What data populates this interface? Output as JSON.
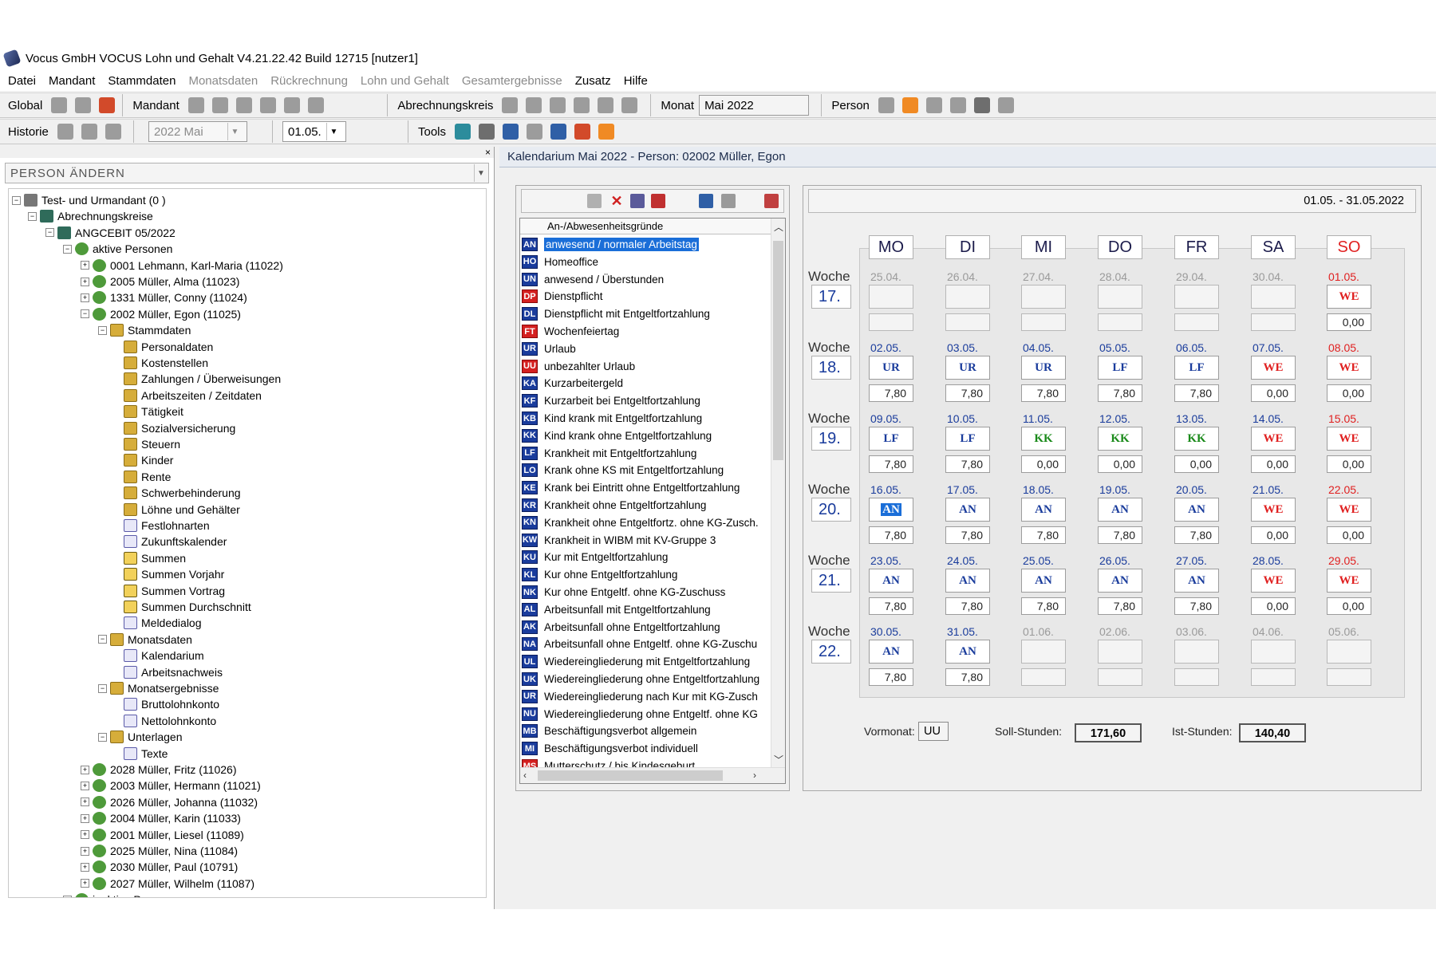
{
  "window": {
    "title": "Vocus GmbH VOCUS Lohn und Gehalt V4.21.22.42 Build 12715 [nutzer1]"
  },
  "menu": [
    {
      "label": "Datei",
      "enabled": true
    },
    {
      "label": "Mandant",
      "enabled": true
    },
    {
      "label": "Stammdaten",
      "enabled": true
    },
    {
      "label": "Monatsdaten",
      "enabled": false
    },
    {
      "label": "Rückrechnung",
      "enabled": false
    },
    {
      "label": "Lohn und Gehalt",
      "enabled": false
    },
    {
      "label": "Gesamtergebnisse",
      "enabled": false
    },
    {
      "label": "Zusatz",
      "enabled": true
    },
    {
      "label": "Hilfe",
      "enabled": true
    }
  ],
  "toolbar": {
    "global_label": "Global",
    "mandant_label": "Mandant",
    "abrechnungskreis_label": "Abrechnungskreis",
    "monat_label": "Monat",
    "monat_value": "Mai 2022",
    "person_label": "Person",
    "historie_label": "Historie",
    "historie_month": "2022 Mai",
    "historie_day": "01.05.",
    "tools_label": "Tools"
  },
  "left_pane": {
    "close_glyph": "×",
    "combo_label": "PERSON ÄNDERN",
    "tree": [
      {
        "label": "Test- und Urmandant  (0 )",
        "level": 0,
        "toggle": "−",
        "icon": "grey"
      },
      {
        "label": "Abrechnungskreise",
        "level": 1,
        "toggle": "−",
        "icon": "net"
      },
      {
        "label": "ANGCEBIT  05/2022",
        "level": 2,
        "toggle": "−",
        "icon": "net"
      },
      {
        "label": "aktive Personen",
        "level": 3,
        "toggle": "−",
        "icon": "pers"
      },
      {
        "label": "0001 Lehmann, Karl-Maria (11022)",
        "level": 4,
        "toggle": "+",
        "icon": "pers"
      },
      {
        "label": "2005 Müller, Alma (11023)",
        "level": 4,
        "toggle": "+",
        "icon": "pers"
      },
      {
        "label": "1331 Müller, Conny (11024)",
        "level": 4,
        "toggle": "+",
        "icon": "pers"
      },
      {
        "label": "2002 Müller, Egon (11025)",
        "level": 4,
        "toggle": "−",
        "icon": "pers"
      },
      {
        "label": "Stammdaten",
        "level": 5,
        "toggle": "−",
        "icon": "fold"
      },
      {
        "label": "Personaldaten",
        "level": 6,
        "toggle": "",
        "icon": "fold"
      },
      {
        "label": "Kostenstellen",
        "level": 6,
        "toggle": "",
        "icon": "fold"
      },
      {
        "label": "Zahlungen / Überweisungen",
        "level": 6,
        "toggle": "",
        "icon": "fold"
      },
      {
        "label": "Arbeitszeiten / Zeitdaten",
        "level": 6,
        "toggle": "",
        "icon": "fold"
      },
      {
        "label": "Tätigkeit",
        "level": 6,
        "toggle": "",
        "icon": "fold"
      },
      {
        "label": "Sozialversicherung",
        "level": 6,
        "toggle": "",
        "icon": "fold"
      },
      {
        "label": "Steuern",
        "level": 6,
        "toggle": "",
        "icon": "fold"
      },
      {
        "label": "Kinder",
        "level": 6,
        "toggle": "",
        "icon": "fold"
      },
      {
        "label": "Rente",
        "level": 6,
        "toggle": "",
        "icon": "fold"
      },
      {
        "label": "Schwerbehinderung",
        "level": 6,
        "toggle": "",
        "icon": "fold"
      },
      {
        "label": "Löhne und Gehälter",
        "level": 6,
        "toggle": "",
        "icon": "fold"
      },
      {
        "label": "Festlohnarten",
        "level": 6,
        "toggle": "",
        "icon": "doc"
      },
      {
        "label": "Zukunftskalender",
        "level": 6,
        "toggle": "",
        "icon": "doc"
      },
      {
        "label": "Summen",
        "level": 6,
        "toggle": "",
        "icon": "sum"
      },
      {
        "label": "Summen Vorjahr",
        "level": 6,
        "toggle": "",
        "icon": "sum"
      },
      {
        "label": "Summen Vortrag",
        "level": 6,
        "toggle": "",
        "icon": "sum"
      },
      {
        "label": "Summen Durchschnitt",
        "level": 6,
        "toggle": "",
        "icon": "sum"
      },
      {
        "label": "Meldedialog",
        "level": 6,
        "toggle": "",
        "icon": "doc"
      },
      {
        "label": "Monatsdaten",
        "level": 5,
        "toggle": "−",
        "icon": "fold"
      },
      {
        "label": "Kalendarium",
        "level": 6,
        "toggle": "",
        "icon": "doc"
      },
      {
        "label": "Arbeitsnachweis",
        "level": 6,
        "toggle": "",
        "icon": "doc"
      },
      {
        "label": "Monatsergebnisse",
        "level": 5,
        "toggle": "−",
        "icon": "fold"
      },
      {
        "label": "Bruttolohnkonto",
        "level": 6,
        "toggle": "",
        "icon": "doc"
      },
      {
        "label": "Nettolohnkonto",
        "level": 6,
        "toggle": "",
        "icon": "doc"
      },
      {
        "label": "Unterlagen",
        "level": 5,
        "toggle": "−",
        "icon": "fold"
      },
      {
        "label": "Texte",
        "level": 6,
        "toggle": "",
        "icon": "doc"
      },
      {
        "label": "2028 Müller, Fritz (11026)",
        "level": 4,
        "toggle": "+",
        "icon": "pers"
      },
      {
        "label": "2003 Müller, Hermann (11021)",
        "level": 4,
        "toggle": "+",
        "icon": "pers"
      },
      {
        "label": "2026 Müller, Johanna (11032)",
        "level": 4,
        "toggle": "+",
        "icon": "pers"
      },
      {
        "label": "2004 Müller, Karin (11033)",
        "level": 4,
        "toggle": "+",
        "icon": "pers"
      },
      {
        "label": "2001 Müller, Liesel (11089)",
        "level": 4,
        "toggle": "+",
        "icon": "pers"
      },
      {
        "label": "2025 Müller, Nina (11084)",
        "level": 4,
        "toggle": "+",
        "icon": "pers"
      },
      {
        "label": "2030 Müller, Paul (10791)",
        "level": 4,
        "toggle": "+",
        "icon": "pers"
      },
      {
        "label": "2027 Müller, Wilhelm (11087)",
        "level": 4,
        "toggle": "+",
        "icon": "pers"
      },
      {
        "label": "inaktive Personen",
        "level": 3,
        "toggle": "+",
        "icon": "pers"
      }
    ]
  },
  "right_pane": {
    "header": "Kalendarium  Mai 2022 - Person: 02002  Müller, Egon",
    "list_header": "An-/Abwesenheitsgründe",
    "reasons": [
      {
        "code": "AN",
        "label": "anwesend / normaler Arbeitstag",
        "selected": true
      },
      {
        "code": "HO",
        "label": "Homeoffice"
      },
      {
        "code": "UN",
        "label": "anwesend / Überstunden"
      },
      {
        "code": "DP",
        "label": "Dienstpflicht",
        "red": true
      },
      {
        "code": "DL",
        "label": "Dienstpflicht mit Entgeltfortzahlung"
      },
      {
        "code": "FT",
        "label": "Wochenfeiertag",
        "red": true
      },
      {
        "code": "UR",
        "label": "Urlaub"
      },
      {
        "code": "UU",
        "label": "unbezahlter Urlaub",
        "red": true
      },
      {
        "code": "KA",
        "label": "Kurzarbeitergeld"
      },
      {
        "code": "KF",
        "label": "Kurzarbeit bei Entgeltfortzahlung"
      },
      {
        "code": "KB",
        "label": "Kind krank mit Entgeltfortzahlung"
      },
      {
        "code": "KK",
        "label": "Kind krank ohne Entgeltfortzahlung"
      },
      {
        "code": "LF",
        "label": "Krankheit mit Entgeltfortzahlung"
      },
      {
        "code": "LO",
        "label": "Krank ohne KS mit Entgeltfortzahlung"
      },
      {
        "code": "KE",
        "label": "Krank bei Eintritt ohne Entgeltfortzahlung"
      },
      {
        "code": "KR",
        "label": "Krankheit ohne Entgeltfortzahlung"
      },
      {
        "code": "KN",
        "label": "Krankheit ohne Entgeltfortz. ohne KG-Zusch."
      },
      {
        "code": "KW",
        "label": "Krankheit in WIBM mit KV-Gruppe 3"
      },
      {
        "code": "KU",
        "label": "Kur mit Entgeltfortzahlung"
      },
      {
        "code": "KL",
        "label": "Kur ohne Entgeltfortzahlung"
      },
      {
        "code": "NK",
        "label": "Kur ohne Entgeltf. ohne KG-Zuschuss"
      },
      {
        "code": "AL",
        "label": "Arbeitsunfall mit Entgeltfortzahlung"
      },
      {
        "code": "AK",
        "label": "Arbeitsunfall ohne Entgeltfortzahlung"
      },
      {
        "code": "NA",
        "label": "Arbeitsunfall ohne Entgeltf. ohne KG-Zuschu"
      },
      {
        "code": "UL",
        "label": "Wiedereingliederung mit Entgeltfortzahlung"
      },
      {
        "code": "UK",
        "label": "Wiedereingliederung ohne Entgeltfortzahlung"
      },
      {
        "code": "UR",
        "label": "Wiedereingliederung nach Kur mit KG-Zusch"
      },
      {
        "code": "NU",
        "label": "Wiedereingliederung ohne Entgeltf. ohne KG"
      },
      {
        "code": "MB",
        "label": "Beschäftigungsverbot allgemein"
      },
      {
        "code": "MI",
        "label": "Beschäftigungsverbot individuell"
      },
      {
        "code": "MS",
        "label": "Mutterschutz / bis Kindesgeburt",
        "red": true
      }
    ],
    "date_range": "01.05. - 31.05.2022",
    "weekdays": [
      "MO",
      "DI",
      "MI",
      "DO",
      "FR",
      "SA",
      "SO"
    ],
    "woche_label": "Woche",
    "weeks": [
      {
        "num": "17.",
        "days": [
          {
            "date": "25.04.",
            "code": "",
            "hours": "",
            "out": true
          },
          {
            "date": "26.04.",
            "code": "",
            "hours": "",
            "out": true
          },
          {
            "date": "27.04.",
            "code": "",
            "hours": "",
            "out": true
          },
          {
            "date": "28.04.",
            "code": "",
            "hours": "",
            "out": true
          },
          {
            "date": "29.04.",
            "code": "",
            "hours": "",
            "out": true
          },
          {
            "date": "30.04.",
            "code": "",
            "hours": "",
            "out": true
          },
          {
            "date": "01.05.",
            "code": "WE",
            "hours": "0,00"
          }
        ]
      },
      {
        "num": "18.",
        "days": [
          {
            "date": "02.05.",
            "code": "UR",
            "hours": "7,80"
          },
          {
            "date": "03.05.",
            "code": "UR",
            "hours": "7,80"
          },
          {
            "date": "04.05.",
            "code": "UR",
            "hours": "7,80"
          },
          {
            "date": "05.05.",
            "code": "LF",
            "hours": "7,80"
          },
          {
            "date": "06.05.",
            "code": "LF",
            "hours": "7,80"
          },
          {
            "date": "07.05.",
            "code": "WE",
            "hours": "0,00"
          },
          {
            "date": "08.05.",
            "code": "WE",
            "hours": "0,00"
          }
        ]
      },
      {
        "num": "19.",
        "days": [
          {
            "date": "09.05.",
            "code": "LF",
            "hours": "7,80"
          },
          {
            "date": "10.05.",
            "code": "LF",
            "hours": "7,80"
          },
          {
            "date": "11.05.",
            "code": "KK",
            "hours": "0,00"
          },
          {
            "date": "12.05.",
            "code": "KK",
            "hours": "0,00"
          },
          {
            "date": "13.05.",
            "code": "KK",
            "hours": "0,00"
          },
          {
            "date": "14.05.",
            "code": "WE",
            "hours": "0,00"
          },
          {
            "date": "15.05.",
            "code": "WE",
            "hours": "0,00"
          }
        ]
      },
      {
        "num": "20.",
        "days": [
          {
            "date": "16.05.",
            "code": "AN",
            "hours": "7,80",
            "focus": true
          },
          {
            "date": "17.05.",
            "code": "AN",
            "hours": "7,80"
          },
          {
            "date": "18.05.",
            "code": "AN",
            "hours": "7,80"
          },
          {
            "date": "19.05.",
            "code": "AN",
            "hours": "7,80"
          },
          {
            "date": "20.05.",
            "code": "AN",
            "hours": "7,80"
          },
          {
            "date": "21.05.",
            "code": "WE",
            "hours": "0,00"
          },
          {
            "date": "22.05.",
            "code": "WE",
            "hours": "0,00"
          }
        ]
      },
      {
        "num": "21.",
        "days": [
          {
            "date": "23.05.",
            "code": "AN",
            "hours": "7,80"
          },
          {
            "date": "24.05.",
            "code": "AN",
            "hours": "7,80"
          },
          {
            "date": "25.05.",
            "code": "AN",
            "hours": "7,80"
          },
          {
            "date": "26.05.",
            "code": "AN",
            "hours": "7,80"
          },
          {
            "date": "27.05.",
            "code": "AN",
            "hours": "7,80"
          },
          {
            "date": "28.05.",
            "code": "WE",
            "hours": "0,00"
          },
          {
            "date": "29.05.",
            "code": "WE",
            "hours": "0,00"
          }
        ]
      },
      {
        "num": "22.",
        "days": [
          {
            "date": "30.05.",
            "code": "AN",
            "hours": "7,80"
          },
          {
            "date": "31.05.",
            "code": "AN",
            "hours": "7,80"
          },
          {
            "date": "01.06.",
            "code": "",
            "hours": "",
            "out": true
          },
          {
            "date": "02.06.",
            "code": "",
            "hours": "",
            "out": true
          },
          {
            "date": "03.06.",
            "code": "",
            "hours": "",
            "out": true
          },
          {
            "date": "04.06.",
            "code": "",
            "hours": "",
            "out": true
          },
          {
            "date": "05.06.",
            "code": "",
            "hours": "",
            "out": true
          }
        ]
      }
    ],
    "footer": {
      "vormonat_label": "Vormonat:",
      "vormonat_value": "UU",
      "soll_label": "Soll-Stunden:",
      "soll_value": "171,60",
      "ist_label": "Ist-Stunden:",
      "ist_value": "140,40"
    }
  },
  "colors": {
    "accent_blue": "#1a3c9c",
    "weekend_red": "#e02020",
    "sick_child_green": "#1a8a1a",
    "selection": "#1a6ed8"
  }
}
